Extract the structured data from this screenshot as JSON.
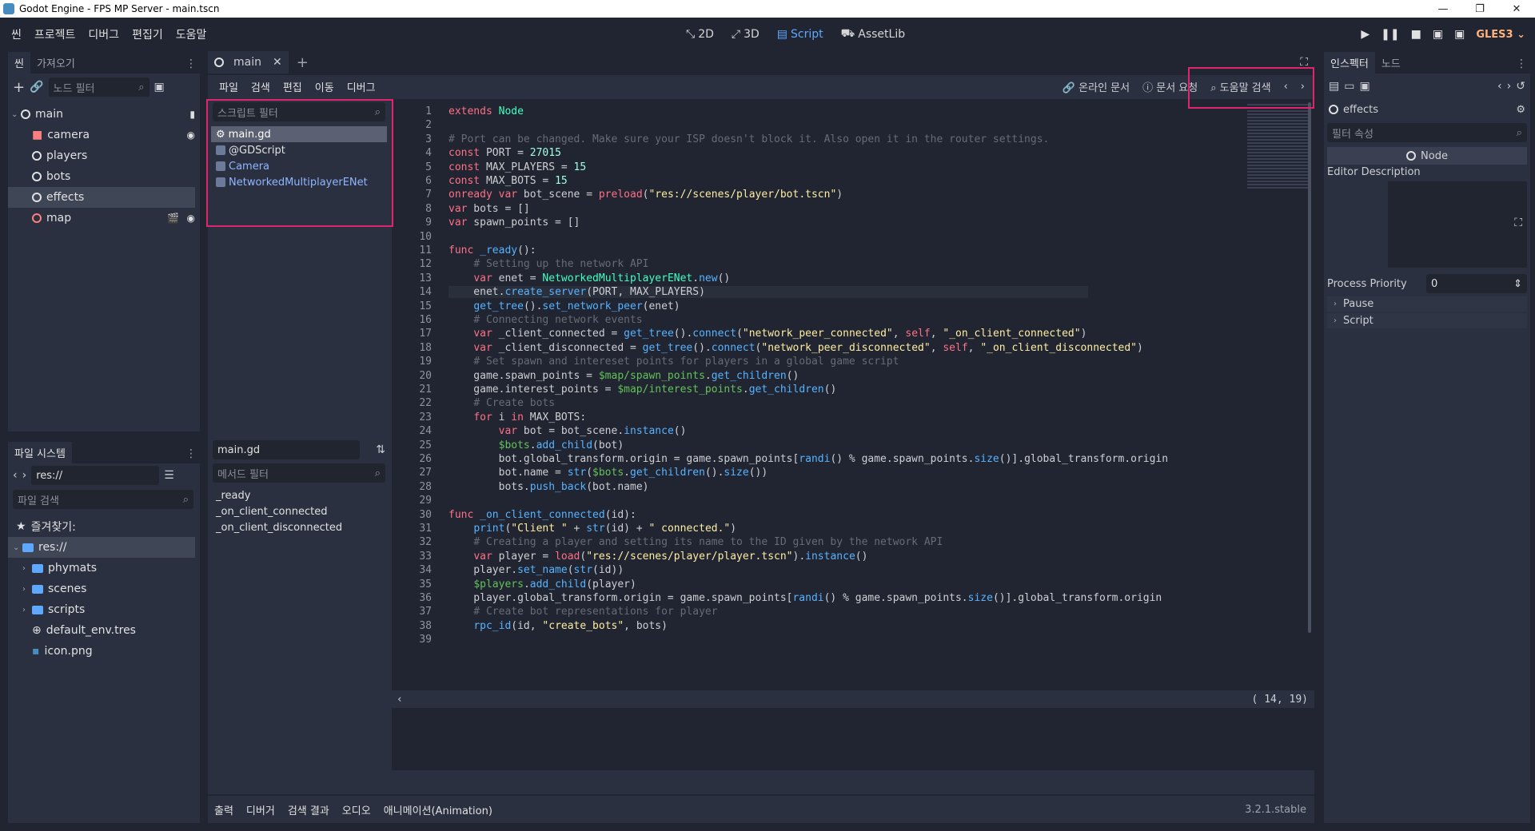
{
  "window": {
    "title": "Godot Engine - FPS MP Server - main.tscn",
    "min": "—",
    "max": "❐",
    "close": "✕"
  },
  "menu": [
    "씬",
    "프로젝트",
    "디버그",
    "편집기",
    "도움말"
  ],
  "modes": [
    {
      "label": "2D",
      "icon": "2d-icon"
    },
    {
      "label": "3D",
      "icon": "3d-icon"
    },
    {
      "label": "Script",
      "icon": "script-icon"
    },
    {
      "label": "AssetLib",
      "icon": "assetlib-icon"
    }
  ],
  "renderer": "GLES3",
  "scene_dock": {
    "tabs": [
      "씬",
      "가져오기"
    ],
    "filter_placeholder": "노드 필터",
    "tree": [
      {
        "label": "main",
        "depth": 0
      },
      {
        "label": "camera",
        "depth": 1
      },
      {
        "label": "players",
        "depth": 1
      },
      {
        "label": "bots",
        "depth": 1
      },
      {
        "label": "effects",
        "depth": 1
      },
      {
        "label": "map",
        "depth": 1
      }
    ]
  },
  "filesystem": {
    "tab": "파일 시스템",
    "path": "res://",
    "search_placeholder": "파일 검색",
    "favorites": "즐겨찾기:",
    "root": "res://",
    "items": [
      "phymats",
      "scenes",
      "scripts",
      "default_env.tres",
      "icon.png"
    ]
  },
  "editor_tab": {
    "label": "main",
    "add": "+"
  },
  "script_menu": [
    "파일",
    "검색",
    "편집",
    "이동",
    "디버그"
  ],
  "script_toolbar": {
    "online_docs": "온라인 문서",
    "request_docs": "문서 요청",
    "search_help": "도움말 검색"
  },
  "script_list": {
    "filter_placeholder": "스크립트 필터",
    "items": [
      "main.gd",
      "@GDScript",
      "Camera",
      "NetworkedMultiplayerENet"
    ]
  },
  "method_panel": {
    "current": "main.gd",
    "filter_placeholder": "메서드 필터",
    "methods": [
      "_ready",
      "_on_client_connected",
      "_on_client_disconnected"
    ]
  },
  "code_lines": [
    "extends Node",
    "",
    "# Port can be changed. Make sure your ISP doesn't block it. Also open it in the router settings.",
    "const PORT = 27015",
    "const MAX_PLAYERS = 15",
    "const MAX_BOTS = 15",
    "onready var bot_scene = preload(\"res://scenes/player/bot.tscn\")",
    "var bots = []",
    "var spawn_points = []",
    "",
    "func _ready():",
    "    # Setting up the network API",
    "    var enet = NetworkedMultiplayerENet.new()",
    "    enet.create_server(PORT, MAX_PLAYERS)",
    "    get_tree().set_network_peer(enet)",
    "    # Connecting network events",
    "    var _client_connected = get_tree().connect(\"network_peer_connected\", self, \"_on_client_connected\")",
    "    var _client_disconnected = get_tree().connect(\"network_peer_disconnected\", self, \"_on_client_disconnected\")",
    "    # Set spawn and intereset points for players in a global game script",
    "    game.spawn_points = $map/spawn_points.get_children()",
    "    game.interest_points = $map/interest_points.get_children()",
    "    # Create bots",
    "    for i in MAX_BOTS:",
    "        var bot = bot_scene.instance()",
    "        $bots.add_child(bot)",
    "        bot.global_transform.origin = game.spawn_points[randi() % game.spawn_points.size()].global_transform.origin",
    "        bot.name = str($bots.get_children().size())",
    "        bots.push_back(bot.name)",
    "",
    "func _on_client_connected(id):",
    "    print(\"Client \" + str(id) + \" connected.\")",
    "    # Creating a player and setting its name to the ID given by the network API",
    "    var player = load(\"res://scenes/player/player.tscn\").instance()",
    "    player.set_name(str(id))",
    "    $players.add_child(player)",
    "    player.global_transform.origin = game.spawn_points[randi() % game.spawn_points.size()].global_transform.origin",
    "    # Create bot representations for player",
    "    rpc_id(id, \"create_bots\", bots)",
    ""
  ],
  "cursor_pos": "( 14, 19)",
  "bottom_tabs": [
    "출력",
    "디버거",
    "검색 결과",
    "오디오",
    "애니메이션(Animation)"
  ],
  "version": "3.2.1.stable",
  "inspector": {
    "tabs": [
      "인스펙터",
      "노드"
    ],
    "object": "effects",
    "filter_placeholder": "필터 속성",
    "class": "Node",
    "editor_description": "Editor Description",
    "process_priority_label": "Process Priority",
    "process_priority_value": "0",
    "sections": [
      "Pause",
      "Script"
    ]
  },
  "colors": {
    "accent": "#5fa8ff",
    "highlight_box": "#e0246d"
  }
}
